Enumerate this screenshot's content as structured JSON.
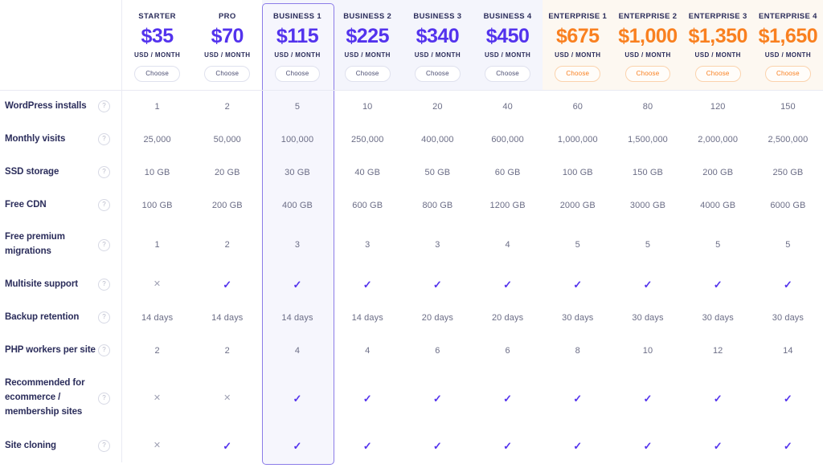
{
  "theme": {
    "purple": "#5333ed",
    "orange": "#f98020",
    "highlight_border": "#8b7ce8",
    "business_band": "#f4f5fc",
    "enterprise_band": "#fdf8f1",
    "divider": "#e9eaf3"
  },
  "plans": [
    {
      "name": "STARTER",
      "price": "$35",
      "period": "USD / MONTH",
      "cta": "Choose",
      "accent": "purple",
      "band": "none",
      "highlight": false
    },
    {
      "name": "PRO",
      "price": "$70",
      "period": "USD / MONTH",
      "cta": "Choose",
      "accent": "purple",
      "band": "none",
      "highlight": false
    },
    {
      "name": "BUSINESS 1",
      "price": "$115",
      "period": "USD / MONTH",
      "cta": "Choose",
      "accent": "purple",
      "band": "business",
      "highlight": true
    },
    {
      "name": "BUSINESS 2",
      "price": "$225",
      "period": "USD / MONTH",
      "cta": "Choose",
      "accent": "purple",
      "band": "business",
      "highlight": false
    },
    {
      "name": "BUSINESS 3",
      "price": "$340",
      "period": "USD / MONTH",
      "cta": "Choose",
      "accent": "purple",
      "band": "business",
      "highlight": false
    },
    {
      "name": "BUSINESS 4",
      "price": "$450",
      "period": "USD / MONTH",
      "cta": "Choose",
      "accent": "purple",
      "band": "business",
      "highlight": false
    },
    {
      "name": "ENTERPRISE 1",
      "price": "$675",
      "period": "USD / MONTH",
      "cta": "Choose",
      "accent": "orange",
      "band": "enterprise",
      "highlight": false
    },
    {
      "name": "ENTERPRISE 2",
      "price": "$1,000",
      "period": "USD / MONTH",
      "cta": "Choose",
      "accent": "orange",
      "band": "enterprise",
      "highlight": false
    },
    {
      "name": "ENTERPRISE 3",
      "price": "$1,350",
      "period": "USD / MONTH",
      "cta": "Choose",
      "accent": "orange",
      "band": "enterprise",
      "highlight": false
    },
    {
      "name": "ENTERPRISE 4",
      "price": "$1,650",
      "period": "USD / MONTH",
      "cta": "Choose",
      "accent": "orange",
      "band": "enterprise",
      "highlight": false
    }
  ],
  "help_icon_glyph": "?",
  "icons": {
    "check": "✓",
    "cross": "✕"
  },
  "features": [
    {
      "label": "WordPress installs",
      "height": 41,
      "values": [
        "1",
        "2",
        "5",
        "10",
        "20",
        "40",
        "60",
        "80",
        "120",
        "150"
      ]
    },
    {
      "label": "Monthly visits",
      "height": 41,
      "values": [
        "25,000",
        "50,000",
        "100,000",
        "250,000",
        "400,000",
        "600,000",
        "1,000,000",
        "1,500,000",
        "2,000,000",
        "2,500,000"
      ]
    },
    {
      "label": "SSD storage",
      "height": 41,
      "values": [
        "10 GB",
        "20 GB",
        "30 GB",
        "40 GB",
        "50 GB",
        "60 GB",
        "100 GB",
        "150 GB",
        "200 GB",
        "250 GB"
      ]
    },
    {
      "label": "Free CDN",
      "height": 41,
      "values": [
        "100 GB",
        "200 GB",
        "400 GB",
        "600 GB",
        "800 GB",
        "1200 GB",
        "2000 GB",
        "3000 GB",
        "4000 GB",
        "6000 GB"
      ]
    },
    {
      "label": "Free premium migrations",
      "height": 58,
      "values": [
        "1",
        "2",
        "3",
        "3",
        "3",
        "4",
        "5",
        "5",
        "5",
        "5"
      ]
    },
    {
      "label": "Multisite support",
      "height": 41,
      "values": [
        "cross",
        "check",
        "check",
        "check",
        "check",
        "check",
        "check",
        "check",
        "check",
        "check"
      ]
    },
    {
      "label": "Backup retention",
      "height": 41,
      "values": [
        "14 days",
        "14 days",
        "14 days",
        "14 days",
        "20 days",
        "20 days",
        "30 days",
        "30 days",
        "30 days",
        "30 days"
      ]
    },
    {
      "label": "PHP workers per site",
      "height": 41,
      "values": [
        "2",
        "2",
        "4",
        "4",
        "6",
        "6",
        "8",
        "10",
        "12",
        "14"
      ]
    },
    {
      "label": "Recommended for ecommerce / membership sites",
      "height": 78,
      "values": [
        "cross",
        "cross",
        "check",
        "check",
        "check",
        "check",
        "check",
        "check",
        "check",
        "check"
      ]
    },
    {
      "label": "Site cloning",
      "height": 41,
      "values": [
        "cross",
        "check",
        "check",
        "check",
        "check",
        "check",
        "check",
        "check",
        "check",
        "check"
      ]
    }
  ]
}
